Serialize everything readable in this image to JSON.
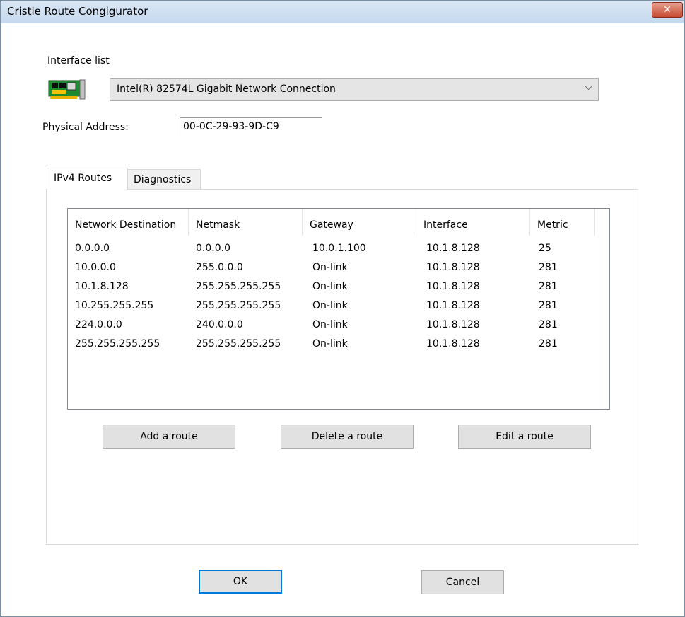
{
  "window": {
    "title": "Cristie Route Congigurator",
    "close_glyph": "✕"
  },
  "interface": {
    "label": "Interface list",
    "selected": "Intel(R) 82574L Gigabit Network Connection",
    "icon": "network-card-icon"
  },
  "physical": {
    "label": "Physical Address:",
    "value": "00-0C-29-93-9D-C9"
  },
  "tabs": [
    {
      "label": "IPv4 Routes",
      "active": true
    },
    {
      "label": "Diagnostics",
      "active": false
    }
  ],
  "routes": {
    "columns": [
      "Network Destination",
      "Netmask",
      "Gateway",
      "Interface",
      "Metric"
    ],
    "rows": [
      [
        "0.0.0.0",
        "0.0.0.0",
        "10.0.1.100",
        "10.1.8.128",
        "25"
      ],
      [
        "10.0.0.0",
        "255.0.0.0",
        "On-link",
        "10.1.8.128",
        "281"
      ],
      [
        "10.1.8.128",
        "255.255.255.255",
        "On-link",
        "10.1.8.128",
        "281"
      ],
      [
        "10.255.255.255",
        "255.255.255.255",
        "On-link",
        "10.1.8.128",
        "281"
      ],
      [
        "224.0.0.0",
        "240.0.0.0",
        "On-link",
        "10.1.8.128",
        "281"
      ],
      [
        "255.255.255.255",
        "255.255.255.255",
        "On-link",
        "10.1.8.128",
        "281"
      ]
    ]
  },
  "buttons": {
    "add": "Add a route",
    "delete": "Delete a route",
    "edit": "Edit a route",
    "ok": "OK",
    "cancel": "Cancel"
  },
  "colors": {
    "default_button_border": "#0078d7",
    "close_button": "#c84a31"
  }
}
